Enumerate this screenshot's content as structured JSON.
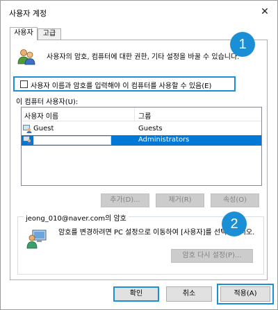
{
  "window": {
    "title": "사용자 계정",
    "close_glyph": "✕"
  },
  "tabs": [
    {
      "label": "사용자",
      "active": true
    },
    {
      "label": "고급",
      "active": false
    }
  ],
  "intro_text": "사용자의 암호, 컴퓨터에 대한 권한, 기타 설정을 바꿀 수 있습니다.",
  "require_login": {
    "label": "사용자 이름과 암호를 입력해야 이 컴퓨터를 사용할 수 있음(E)",
    "checked": false
  },
  "badges": {
    "first": "1",
    "second": "2"
  },
  "users_label": "이 컴퓨터 사용자(U):",
  "users_table": {
    "columns": [
      "사용자 이름",
      "그룹"
    ],
    "rows": [
      {
        "name": "Guest",
        "group": "Guests",
        "selected": false
      },
      {
        "name": "",
        "group": "Administrators",
        "selected": true
      }
    ]
  },
  "list_buttons": {
    "add": "추가(D)...",
    "remove": "제거(R)",
    "properties": "속성(O)"
  },
  "password_group": {
    "title": "jeong_010@naver.com의 암호",
    "text": "암호를 변경하려면 PC 설정으로 이동하여 [사용자]를 선택하십시오.",
    "reset_button": "암호 다시 설정(P)..."
  },
  "footer": {
    "ok": "확인",
    "cancel": "취소",
    "apply": "적용(A)"
  },
  "colors": {
    "accent": "#1a8fd6",
    "selection": "#0078d7"
  }
}
